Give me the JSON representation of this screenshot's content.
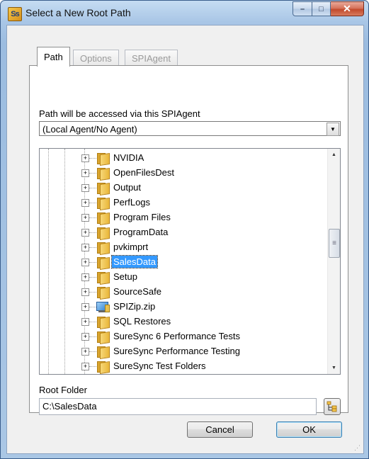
{
  "window": {
    "title": "Select a New Root Path",
    "app_icon_text": "Ss",
    "minimize_glyph": "–",
    "maximize_glyph": "□",
    "close_glyph": "✕"
  },
  "tabs": [
    {
      "label": "Path",
      "active": true
    },
    {
      "label": "Options",
      "active": false
    },
    {
      "label": "SPIAgent",
      "active": false
    }
  ],
  "agent": {
    "label": "Path will be accessed via this SPIAgent",
    "selected": "(Local Agent/No Agent)"
  },
  "tree": {
    "items": [
      {
        "label": "NVIDIA",
        "icon": "folder-icon"
      },
      {
        "label": "OpenFilesDest",
        "icon": "folder-icon"
      },
      {
        "label": "Output",
        "icon": "folder-icon"
      },
      {
        "label": "PerfLogs",
        "icon": "folder-icon"
      },
      {
        "label": "Program Files",
        "icon": "folder-icon"
      },
      {
        "label": "ProgramData",
        "icon": "folder-icon"
      },
      {
        "label": "pvkimprt",
        "icon": "folder-icon"
      },
      {
        "label": "SalesData",
        "icon": "folder-icon",
        "selected": true
      },
      {
        "label": "Setup",
        "icon": "folder-icon"
      },
      {
        "label": "SourceSafe",
        "icon": "folder-icon"
      },
      {
        "label": "SPIZip.zip",
        "icon": "zip-file-icon"
      },
      {
        "label": "SQL Restores",
        "icon": "folder-icon"
      },
      {
        "label": "SureSync 6 Performance Tests",
        "icon": "folder-icon"
      },
      {
        "label": "SureSync Performance Testing",
        "icon": "folder-icon"
      },
      {
        "label": "SureSync Test Folders",
        "icon": "folder-icon"
      }
    ],
    "scroll_position": 0.42
  },
  "root_folder": {
    "label": "Root Folder",
    "value": "C:\\SalesData"
  },
  "buttons": {
    "cancel": "Cancel",
    "ok": "OK"
  },
  "colors": {
    "selection": "#3399ff",
    "title_bar": "#a9c6e6",
    "close_button": "#c24a2d"
  }
}
